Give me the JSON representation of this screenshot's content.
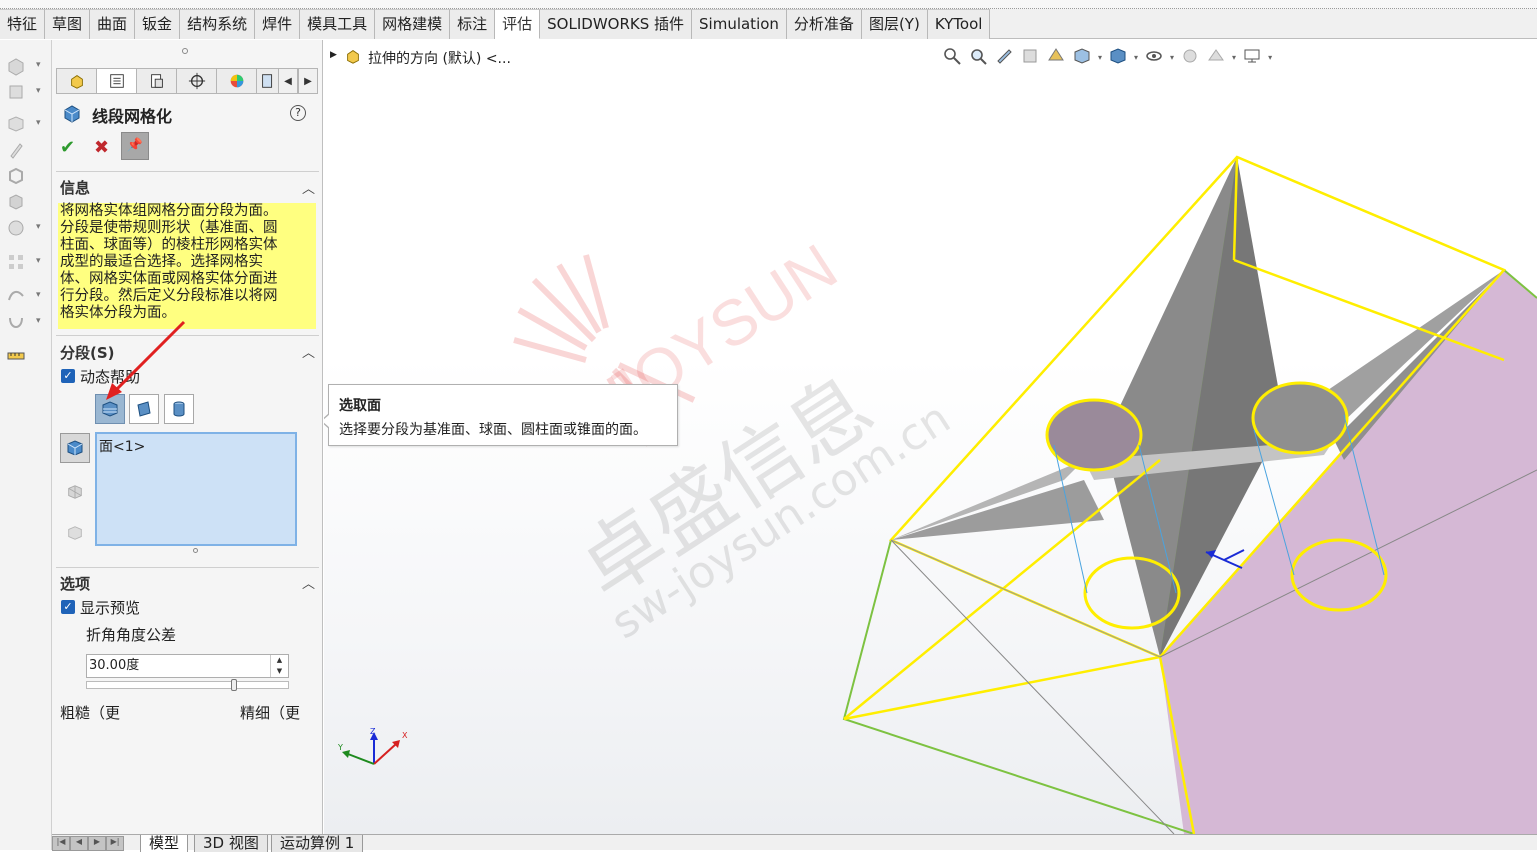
{
  "ribbon": {
    "tabs": [
      "特征",
      "草图",
      "曲面",
      "钣金",
      "结构系统",
      "焊件",
      "模具工具",
      "网格建模",
      "标注",
      "评估",
      "SOLIDWORKS 插件",
      "Simulation",
      "分析准备",
      "图层(Y)",
      "KYTool"
    ],
    "active_tab": "评估"
  },
  "property_manager": {
    "title": "线段网格化",
    "help": "?",
    "pin": "📌",
    "sections": {
      "info": {
        "header": "信息",
        "text_lines": [
          "将网格实体组网格分面分段为面。",
          "分段是使带规则形状（基准面、圆",
          "柱面、球面等）的棱柱形网格实体",
          "成型的最适合选择。选择网格实",
          "体、网格实体面或网格实体分面进",
          "行分段。然后定义分段标准以将网",
          "格实体分段为面。"
        ]
      },
      "segment": {
        "header": "分段(S)",
        "dynamic_help_label": "动态帮助",
        "dynamic_help_checked": true,
        "selection_item": "面<1>"
      },
      "options": {
        "header": "选项",
        "show_preview_label": "显示预览",
        "show_preview_checked": true,
        "angle_label": "折角角度公差",
        "angle_value": "30.00度",
        "slider_fraction": 0.74,
        "coarse_label": "粗糙（更",
        "fine_label": "精细（更"
      }
    }
  },
  "graphics": {
    "tree_label": "拉伸的方向 (默认) <...",
    "tooltip": {
      "title": "选取面",
      "description": "选择要分段为基准面、球面、圆柱面或锥面的面。"
    },
    "watermark": {
      "brand": "JOYSUN",
      "cn": "卓盛信息",
      "url": "sw-joysun.com.cn"
    },
    "triad": {
      "x": "X",
      "y": "Y",
      "z": "Z"
    }
  },
  "bottom_tabs": [
    "模型",
    "3D 视图",
    "运动算例 1"
  ],
  "colors": {
    "accent_blue": "#1f63b8",
    "info_yellow": "#ffff80",
    "selection_blue": "#cde1f6",
    "highlight_yellow": "#ffee00",
    "face_purple": "#d5b8d5",
    "edge_green": "#7dc241"
  }
}
